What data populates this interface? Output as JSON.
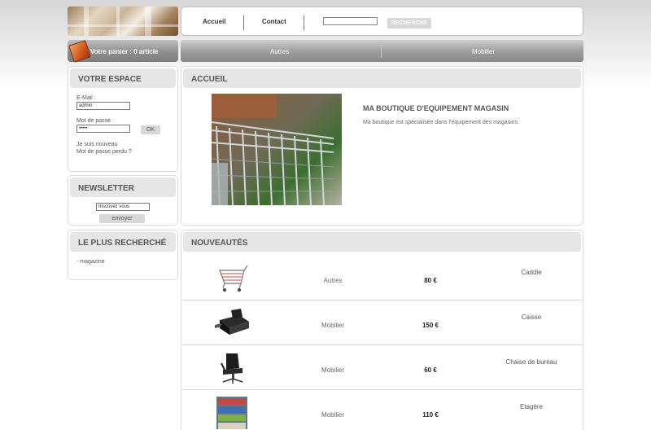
{
  "header": {
    "nav": [
      {
        "label": "Accueil"
      },
      {
        "label": "Contact"
      }
    ],
    "search": {
      "placeholder": "",
      "button_label": "RECHERCHE"
    }
  },
  "cart": {
    "text": "Votre panier : 0 article",
    "icon": "cart-box-icon"
  },
  "categories": [
    {
      "label": "Autres"
    },
    {
      "label": "Mobilier"
    }
  ],
  "sidebar": {
    "espace": {
      "title": "VOTRE ESPACE",
      "email_label": "E-Mail :",
      "email_value": "admin",
      "password_label": "Mot de passe :",
      "password_value": "•••••",
      "ok_label": "OK",
      "new_user_link": "Je suis nouveau",
      "forgot_link": "Mot de passe perdu ?"
    },
    "newsletter": {
      "title": "NEWSLETTER",
      "input_value": "Inscrivez vous",
      "button_label": "envoyer"
    },
    "popular": {
      "title": "LE PLUS RECHERCHÉ",
      "items": [
        "- magazine"
      ]
    }
  },
  "main": {
    "home": {
      "title": "ACCUEIL",
      "heading": "MA BOUTIQUE D'EQUIPEMENT MAGASIN",
      "text": "Ma boutique est spécialisée dans l'équipement des magasins."
    },
    "news": {
      "title": "NOUVEAUTÉS",
      "products": [
        {
          "category": "Autres",
          "price": "80 €",
          "name": "Caddie",
          "icon": "shopping-cart-icon"
        },
        {
          "category": "Mobilier",
          "price": "150 €",
          "name": "Caisse",
          "icon": "cash-register-icon"
        },
        {
          "category": "Mobilier",
          "price": "60 €",
          "name": "Chaise de bureau",
          "icon": "office-chair-icon"
        },
        {
          "category": "Mobilier",
          "price": "110 €",
          "name": "Etagère",
          "icon": "shelf-icon"
        }
      ]
    }
  },
  "colors": {
    "accent_orange": "#d0571d",
    "bar_grey": "#8e8e8e",
    "box_head": "#e6e6e6"
  }
}
